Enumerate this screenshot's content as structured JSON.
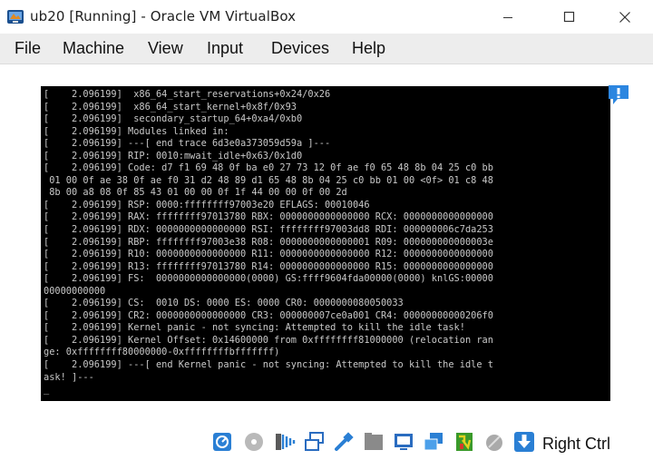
{
  "window": {
    "title": "ub20 [Running] - Oracle VM VirtualBox",
    "app_icon": "virtualbox-icon",
    "controls": [
      "minimize-icon",
      "maximize-icon",
      "close-icon"
    ]
  },
  "menu": {
    "items": [
      "File",
      "Machine",
      "View",
      "Input",
      "Devices",
      "Help"
    ]
  },
  "console": {
    "lines": [
      "[    2.096199]  x86_64_start_reservations+0x24/0x26",
      "[    2.096199]  x86_64_start_kernel+0x8f/0x93",
      "[    2.096199]  secondary_startup_64+0xa4/0xb0",
      "[    2.096199] Modules linked in:",
      "[    2.096199] ---[ end trace 6d3e0a373059d59a ]---",
      "[    2.096199] RIP: 0010:mwait_idle+0x63/0x1d0",
      "[    2.096199] Code: d7 f1 69 48 0f ba e0 27 73 12 0f ae f0 65 48 8b 04 25 c0 bb",
      " 01 00 0f ae 38 0f ae f0 31 d2 48 89 d1 65 48 8b 04 25 c0 bb 01 00 <0f> 01 c8 48",
      " 8b 00 a8 08 0f 85 43 01 00 00 0f 1f 44 00 00 0f 00 2d",
      "[    2.096199] RSP: 0000:ffffffff97003e20 EFLAGS: 00010046",
      "[    2.096199] RAX: ffffffff97013780 RBX: 0000000000000000 RCX: 0000000000000000",
      "[    2.096199] RDX: 0000000000000000 RSI: ffffffff97003dd8 RDI: 000000006c7da253",
      "[    2.096199] RBP: ffffffff97003e38 R08: 0000000000000001 R09: 000000000000003e",
      "[    2.096199] R10: 0000000000000000 R11: 0000000000000000 R12: 0000000000000000",
      "[    2.096199] R13: ffffffff97013780 R14: 0000000000000000 R15: 0000000000000000",
      "[    2.096199] FS:  0000000000000000(0000) GS:ffff9604fda00000(0000) knlGS:00000",
      "00000000000",
      "[    2.096199] CS:  0010 DS: 0000 ES: 0000 CR0: 0000000080050033",
      "[    2.096199] CR2: 0000000000000000 CR3: 000000007ce0a001 CR4: 00000000000206f0",
      "[    2.096199] Kernel panic - not syncing: Attempted to kill the idle task!",
      "[    2.096199] Kernel Offset: 0x14600000 from 0xffffffff81000000 (relocation ran",
      "ge: 0xffffffff80000000-0xffffffffbfffffff)",
      "[    2.096199] ---[ end Kernel panic - not syncing: Attempted to kill the idle t",
      "ask! ]---",
      "_"
    ]
  },
  "notification": {
    "icon": "notification-exclamation-icon"
  },
  "statusbar": {
    "icons": [
      "hard-disk-icon",
      "optical-drive-icon",
      "audio-icon",
      "network-icon",
      "usb-icon",
      "shared-folders-icon",
      "display-icon",
      "video-capture-icon",
      "cpu-activity-icon",
      "mouse-integration-icon",
      "host-key-arrow-icon"
    ],
    "host_key": "Right Ctrl"
  },
  "colors": {
    "menubar_bg": "#ededed",
    "console_bg": "#000000",
    "console_text": "#c8c8c8",
    "accent_blue": "#1e6fd0"
  }
}
